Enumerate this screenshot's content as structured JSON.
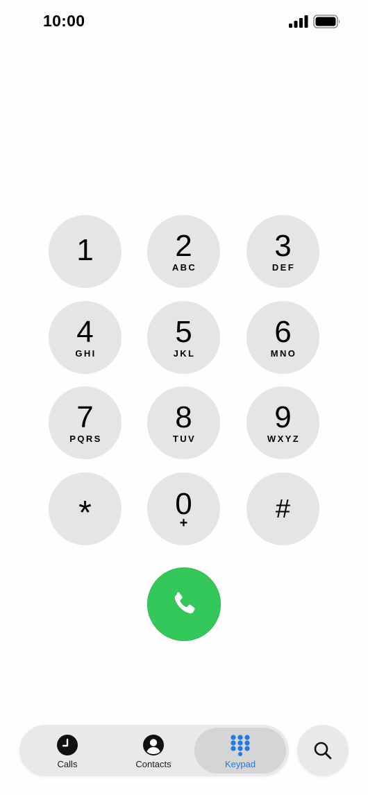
{
  "status_bar": {
    "time": "10:00",
    "signal_icon": "cellular-signal-icon",
    "battery_icon": "battery-icon"
  },
  "keypad": {
    "keys": [
      {
        "digit": "1",
        "letters": ""
      },
      {
        "digit": "2",
        "letters": "ABC"
      },
      {
        "digit": "3",
        "letters": "DEF"
      },
      {
        "digit": "4",
        "letters": "GHI"
      },
      {
        "digit": "5",
        "letters": "JKL"
      },
      {
        "digit": "6",
        "letters": "MNO"
      },
      {
        "digit": "7",
        "letters": "PQRS"
      },
      {
        "digit": "8",
        "letters": "TUV"
      },
      {
        "digit": "9",
        "letters": "WXYZ"
      },
      {
        "digit": "*",
        "letters": ""
      },
      {
        "digit": "0",
        "letters": "+"
      },
      {
        "digit": "#",
        "letters": ""
      }
    ],
    "call_icon": "phone-icon"
  },
  "tab_bar": {
    "tabs": [
      {
        "label": "Calls",
        "icon": "clock-icon",
        "selected": false
      },
      {
        "label": "Contacts",
        "icon": "person-circle-icon",
        "selected": false
      },
      {
        "label": "Keypad",
        "icon": "keypad-grid-icon",
        "selected": true
      }
    ],
    "search_icon": "search-icon"
  },
  "colors": {
    "key_background": "#e5e5e5",
    "call_green": "#34c759",
    "accent_blue": "#1d7ae6",
    "tab_bar_background": "#e9e9e9"
  }
}
